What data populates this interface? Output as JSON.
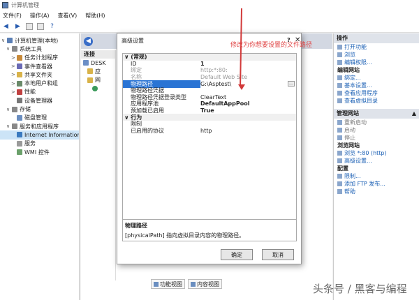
{
  "window": {
    "title": "计算机管理"
  },
  "menu": [
    "文件(F)",
    "操作(A)",
    "查看(V)",
    "帮助(H)"
  ],
  "tree": [
    {
      "label": "计算机管理(本地)",
      "indent": 0,
      "arrow": "∨"
    },
    {
      "label": "系统工具",
      "indent": 1,
      "arrow": "∨"
    },
    {
      "label": "任务计划程序",
      "indent": 2,
      "arrow": ">"
    },
    {
      "label": "事件查看器",
      "indent": 2,
      "arrow": ">"
    },
    {
      "label": "共享文件夹",
      "indent": 2,
      "arrow": ">"
    },
    {
      "label": "本地用户和组",
      "indent": 2,
      "arrow": ">"
    },
    {
      "label": "性能",
      "indent": 2,
      "arrow": ">"
    },
    {
      "label": "设备管理器",
      "indent": 2,
      "arrow": ""
    },
    {
      "label": "存储",
      "indent": 1,
      "arrow": "∨"
    },
    {
      "label": "磁盘管理",
      "indent": 2,
      "arrow": ""
    },
    {
      "label": "服务和应用程序",
      "indent": 1,
      "arrow": "∨"
    },
    {
      "label": "Internet Information S",
      "indent": 2,
      "arrow": "",
      "selected": true
    },
    {
      "label": "服务",
      "indent": 2,
      "arrow": ""
    },
    {
      "label": "WMI 控件",
      "indent": 2,
      "arrow": ""
    }
  ],
  "connections": {
    "header": "连接",
    "items": [
      "DESK",
      "应",
      "网"
    ]
  },
  "bottom_tabs": [
    "功能视图",
    "内容视图"
  ],
  "actions": {
    "header": "操作",
    "items": [
      {
        "label": "打开功能",
        "kind": "link"
      },
      {
        "label": "浏览",
        "kind": "link"
      },
      {
        "label": "编辑权限...",
        "kind": "link"
      },
      {
        "label": "编辑网站",
        "kind": "head"
      },
      {
        "label": "绑定...",
        "kind": "link"
      },
      {
        "label": "基本设置...",
        "kind": "link"
      },
      {
        "label": "查看应用程序",
        "kind": "link"
      },
      {
        "label": "查看虚拟目录",
        "kind": "link"
      }
    ],
    "manage_header": "管理网站",
    "manage_items": [
      {
        "label": "重新启动",
        "kind": "plain"
      },
      {
        "label": "启动",
        "kind": "plain"
      },
      {
        "label": "停止",
        "kind": "plain"
      },
      {
        "label": "浏览网站",
        "kind": "head"
      },
      {
        "label": "浏览 *:80 (http)",
        "kind": "link"
      },
      {
        "label": "高级设置...",
        "kind": "link"
      },
      {
        "label": "配置",
        "kind": "head"
      },
      {
        "label": "限制...",
        "kind": "link"
      },
      {
        "label": "添加 FTP 发布...",
        "kind": "link"
      },
      {
        "label": "帮助",
        "kind": "link"
      }
    ]
  },
  "dialog": {
    "title": "高级设置",
    "help": "?",
    "close": "✕",
    "rows": [
      {
        "k": "(常规)",
        "v": "",
        "type": "cat"
      },
      {
        "k": "ID",
        "v": "1",
        "type": "bold"
      },
      {
        "k": "绑定",
        "v": "http:*:80:",
        "type": "dim"
      },
      {
        "k": "名称",
        "v": "Default Web Site",
        "type": "dim"
      },
      {
        "k": "物理路径",
        "v": "G:\\Asptest\\",
        "type": "selrow"
      },
      {
        "k": "物理路径凭据",
        "v": "",
        "type": ""
      },
      {
        "k": "物理路径凭据登录类型",
        "v": "ClearText",
        "type": ""
      },
      {
        "k": "应用程序池",
        "v": "DefaultAppPool",
        "type": "bold"
      },
      {
        "k": "预加载已启用",
        "v": "True",
        "type": "bold"
      },
      {
        "k": "行为",
        "v": "",
        "type": "cat"
      },
      {
        "k": "限制",
        "v": "",
        "type": ""
      },
      {
        "k": "已启用的协议",
        "v": "http",
        "type": ""
      }
    ],
    "desc_title": "物理路径",
    "desc_text": "[physicalPath] 指向虚拟目录内容的物理路径。",
    "ok": "确定",
    "cancel": "取消"
  },
  "annotation": "修改为你想要设置的文件路径",
  "watermark": "头条号 / 黑客与编程",
  "colors": {
    "accent": "#2a74d4",
    "annotation": "#e04848"
  }
}
